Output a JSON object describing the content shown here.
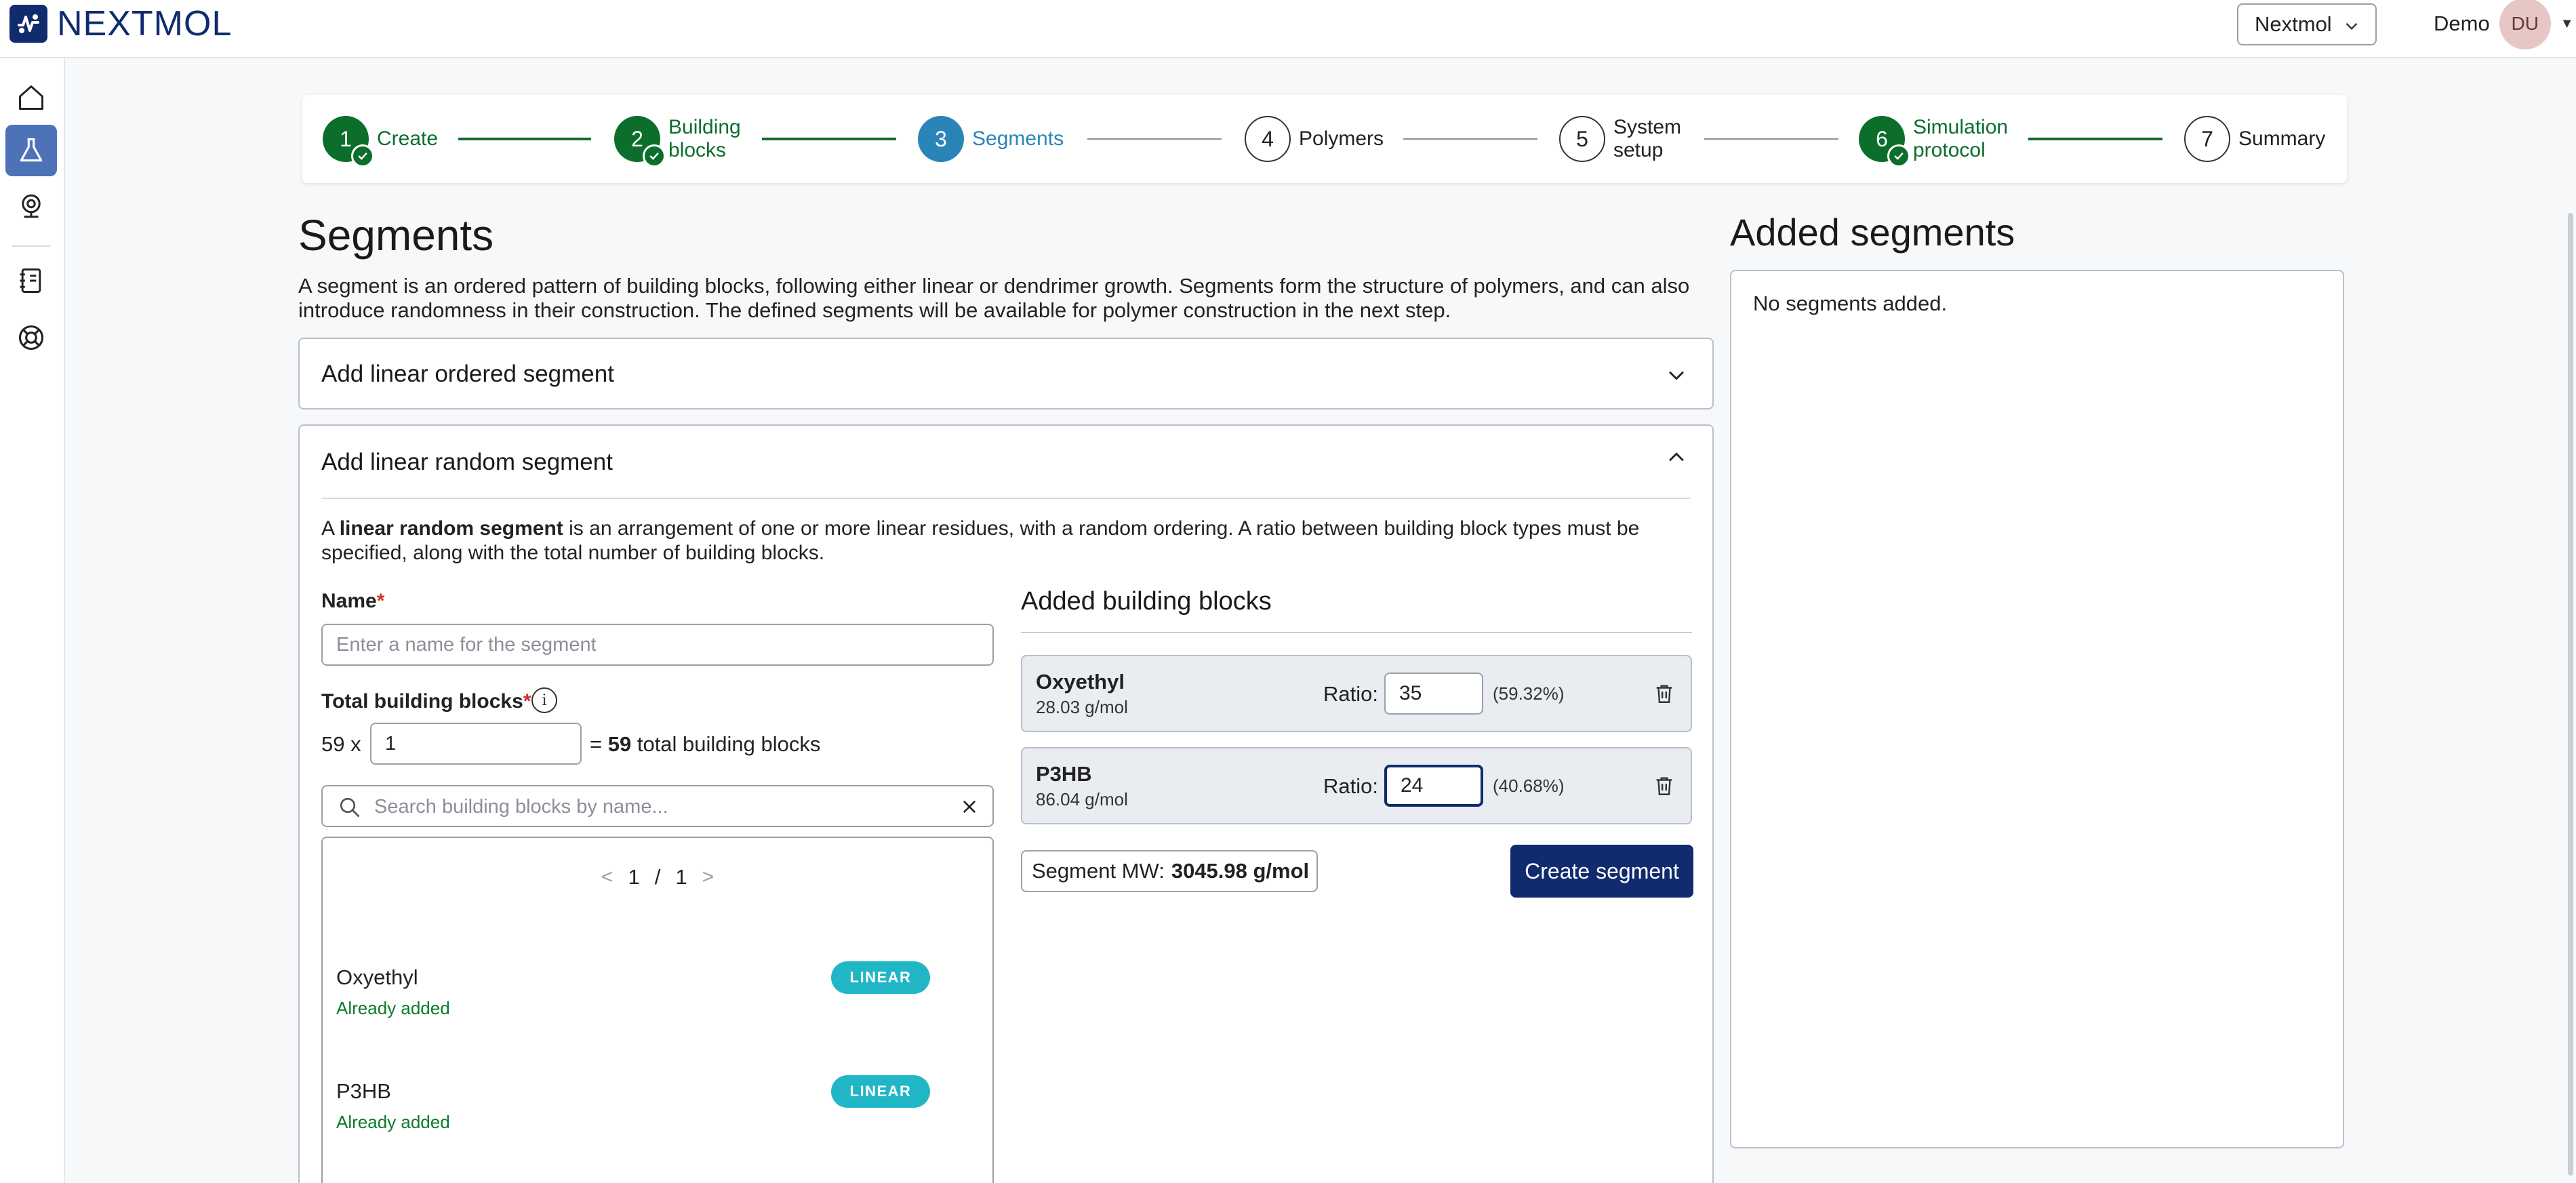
{
  "app": {
    "logo_text": "NEXTMOL",
    "brand_color": "#102b6e"
  },
  "header": {
    "environment": "Nextmol",
    "user_name": "Demo",
    "user_initials": "DU"
  },
  "sidebar": {
    "items": [
      {
        "icon": "home-icon",
        "active": false
      },
      {
        "icon": "flask-icon",
        "active": true
      },
      {
        "icon": "webcam-icon",
        "active": false
      },
      {
        "icon": "notebook-icon",
        "active": false
      },
      {
        "icon": "lifebuoy-icon",
        "active": false
      }
    ]
  },
  "stepper": {
    "steps": [
      {
        "number": "1",
        "label": "Create",
        "state": "done"
      },
      {
        "number": "2",
        "label_line1": "Building",
        "label_line2": "blocks",
        "state": "done"
      },
      {
        "number": "3",
        "label": "Segments",
        "state": "current"
      },
      {
        "number": "4",
        "label": "Polymers",
        "state": "todo"
      },
      {
        "number": "5",
        "label_line1": "System",
        "label_line2": "setup",
        "state": "todo"
      },
      {
        "number": "6",
        "label_line1": "Simulation",
        "label_line2": "protocol",
        "state": "done"
      },
      {
        "number": "7",
        "label": "Summary",
        "state": "todo"
      }
    ]
  },
  "main": {
    "title": "Segments",
    "intro_line1": "A segment is an ordered pattern of building blocks, following either linear or dendrimer growth. Segments form the structure of polymers, and can also",
    "intro_line2": "introduce randomness in their construction. The defined segments will be available for polymer construction in the next step."
  },
  "linear_ordered": {
    "title": "Add linear ordered segment"
  },
  "linear_random": {
    "title": "Add linear random segment",
    "desc_prefix": "A ",
    "desc_bold": "linear random segment",
    "desc_rest": " is an arrangement of one or more linear residues, with a random ordering. A ratio between building block types must be",
    "desc_line2": "specified, along with the total number of building blocks.",
    "name_label": "Name",
    "required_mark": "*",
    "name_placeholder": "Enter a name for the segment",
    "name_value": "",
    "total_label": "Total building blocks",
    "info_glyph": "i",
    "multiplier_prefix": "59 x",
    "multiplier_value": "1",
    "total_equals": "=",
    "total_value": "59",
    "total_suffix": "total building blocks",
    "search_placeholder": "Search building blocks by name...",
    "pager": {
      "prev": "<",
      "current": "1",
      "sep": "/",
      "total": "1",
      "next": ">"
    },
    "building_blocks": [
      {
        "name": "Oxyethyl",
        "status": "Already added",
        "badge": "LINEAR"
      },
      {
        "name": "P3HB",
        "status": "Already added",
        "badge": "LINEAR"
      }
    ],
    "added_title": "Added building blocks",
    "added": [
      {
        "name": "Oxyethyl",
        "mw": "28.03 g/mol",
        "ratio_label": "Ratio:",
        "ratio": "35",
        "percent": "(59.32%)"
      },
      {
        "name": "P3HB",
        "mw": "86.04 g/mol",
        "ratio_label": "Ratio:",
        "ratio": "24",
        "percent": "(40.68%)"
      }
    ],
    "segment_mw_label": "Segment MW:",
    "segment_mw_value": "3045.98 g/mol",
    "create_button": "Create segment"
  },
  "added_segments": {
    "title": "Added segments",
    "empty_text": "No segments added."
  },
  "colors": {
    "done": "#0b6e2b",
    "current": "#2a84b8",
    "badge": "#21b6c6",
    "required": "#d32f2f"
  }
}
